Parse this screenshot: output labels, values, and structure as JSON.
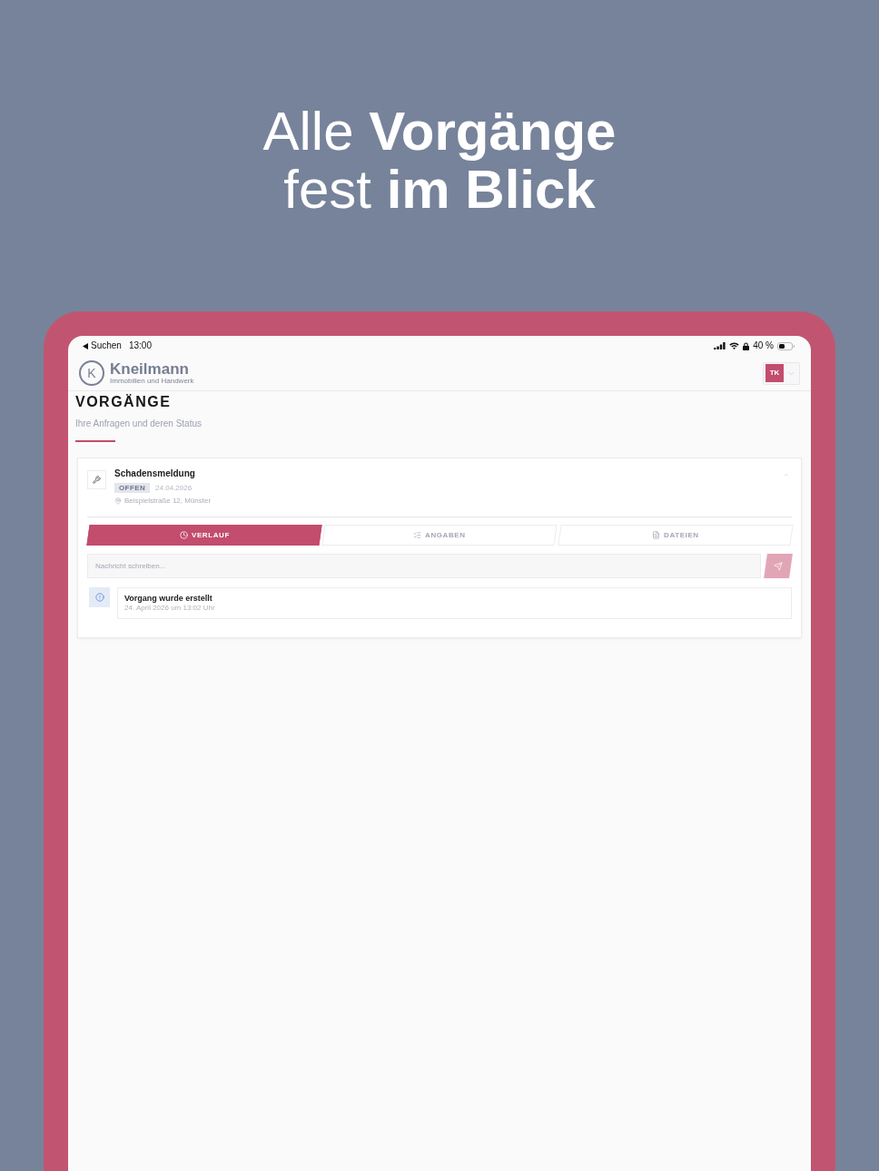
{
  "headline": "Alle **Vorgänge** fest **im Blick**",
  "status_bar": {
    "back_label": "Suchen",
    "time": "13:00",
    "battery": "40 %"
  },
  "header": {
    "logo_mark": "K",
    "logo_name": "Kneilmann",
    "logo_tagline": "Immobilien und Handwerk",
    "user_initials": "TK"
  },
  "page": {
    "title": "VORGÄNGE",
    "subtitle": "Ihre Anfragen und deren Status"
  },
  "cases": [
    {
      "title": "Schadensmeldung",
      "status": "OFFEN",
      "date": "24.04.2026",
      "address": "Beispielstraße 12, Münster",
      "expanded": true,
      "tabs": [
        {
          "label": "VERLAUF",
          "selected": true
        },
        {
          "label": "ANGABEN",
          "selected": false
        },
        {
          "label": "DATEIEN",
          "selected": false
        }
      ],
      "message": {
        "placeholder": "Nachricht schreiben..."
      },
      "send_button": {
        "disabled": true
      },
      "timeline": [
        {
          "title": "Vorgang wurde erstellt",
          "time": "24. April 2026 um 13:02 Uhr"
        }
      ]
    }
  ]
}
